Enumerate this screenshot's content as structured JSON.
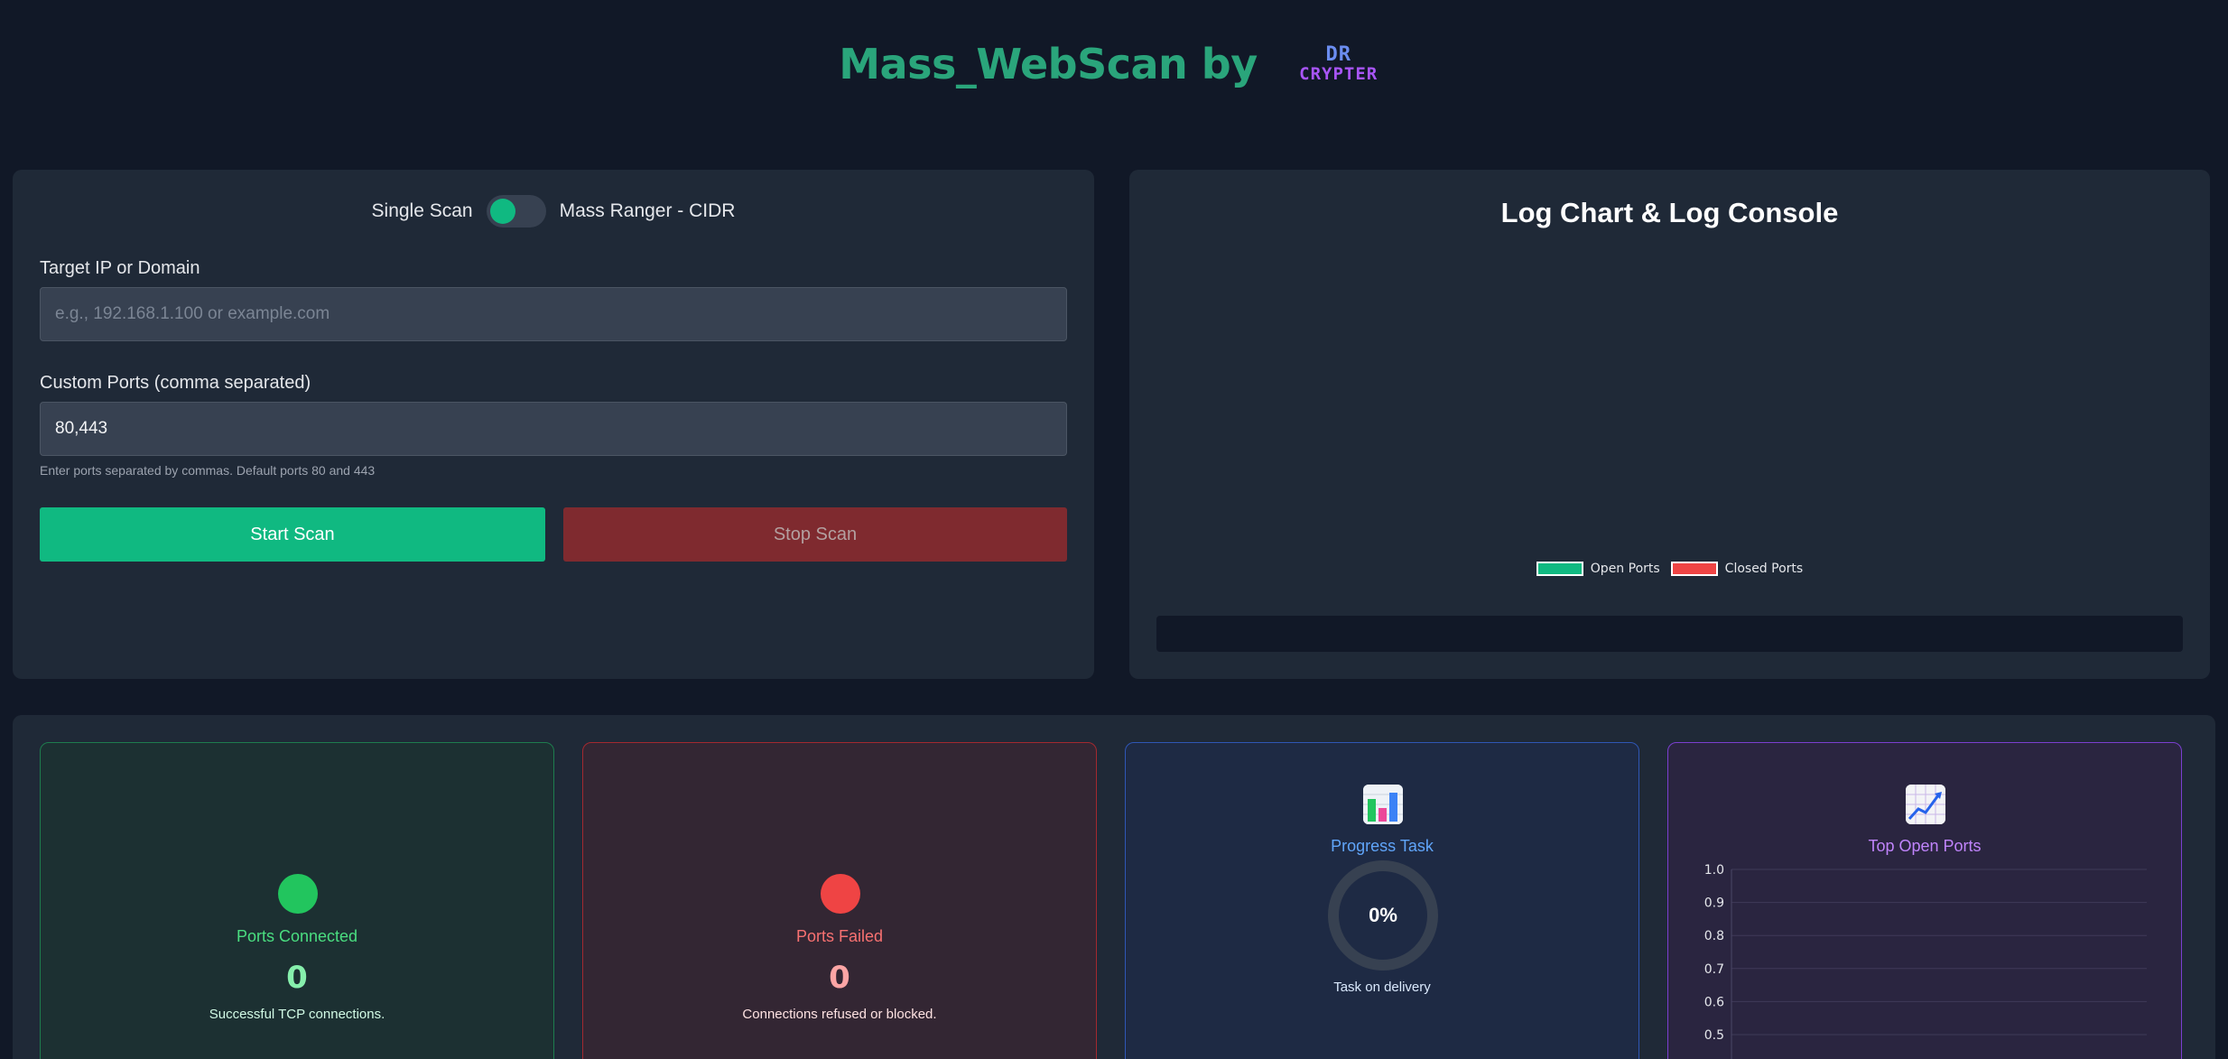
{
  "header": {
    "title": "Mass_WebScan by",
    "logo_line1": "DR",
    "logo_line2": "CRYPTER"
  },
  "scan_form": {
    "mode_single": "Single Scan",
    "mode_mass": "Mass Ranger - CIDR",
    "mode_toggle_on": false,
    "target_label": "Target IP or Domain",
    "target_placeholder": "e.g., 192.168.1.100 or example.com",
    "target_value": "",
    "ports_label": "Custom Ports (comma separated)",
    "ports_value": "80,443",
    "ports_hint": "Enter ports separated by commas. Default ports 80 and 443",
    "start_label": "Start Scan",
    "stop_label": "Stop Scan"
  },
  "log_panel": {
    "title": "Log Chart & Log Console",
    "legend_open": "Open Ports",
    "legend_closed": "Closed Ports",
    "open_color": "#10b981",
    "closed_color": "#ef4444"
  },
  "stats": {
    "connected": {
      "label": "Ports Connected",
      "value": "0",
      "desc": "Successful TCP connections.",
      "color": "#22c55e"
    },
    "failed": {
      "label": "Ports Failed",
      "value": "0",
      "desc": "Connections refused or blocked.",
      "color": "#ef4444"
    },
    "progress": {
      "icon": "bar-chart-icon",
      "label": "Progress Task",
      "percent": "0%",
      "desc": "Task on delivery"
    },
    "top_ports": {
      "icon": "line-chart-icon",
      "label": "Top Open Ports"
    }
  },
  "chart_data": {
    "type": "bar",
    "title": "Top Open Ports",
    "categories": [],
    "values": [],
    "ylim": [
      0,
      1.0
    ],
    "yticks": [
      "1.0",
      "0.9",
      "0.8",
      "0.7",
      "0.6",
      "0.5"
    ],
    "grid": true
  }
}
